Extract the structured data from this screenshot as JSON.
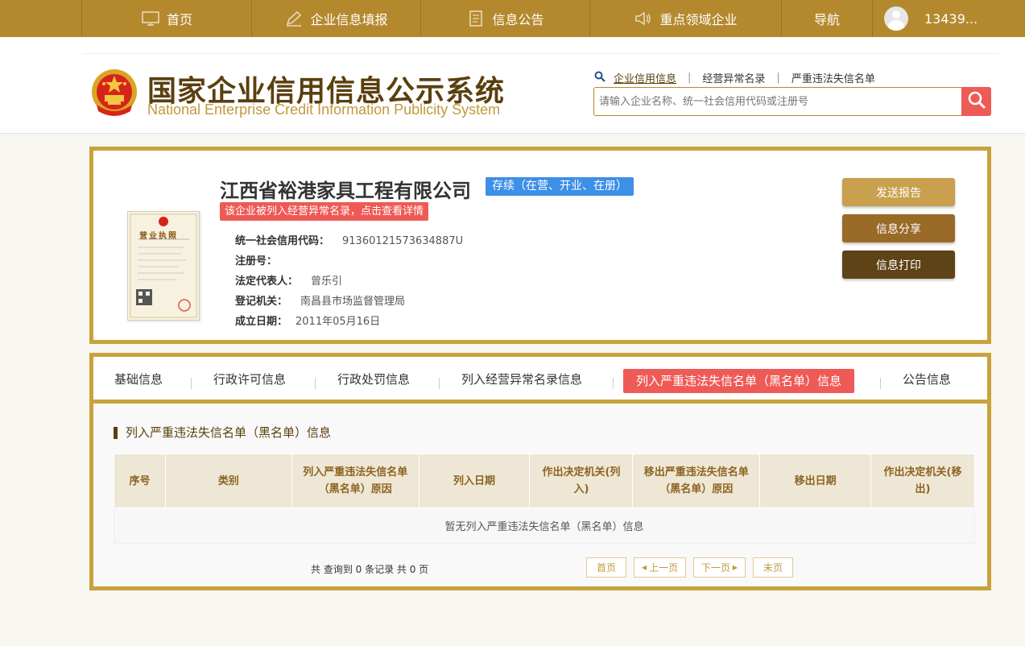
{
  "nav": {
    "items": [
      {
        "label": "首页",
        "icon": "monitor-icon"
      },
      {
        "label": "企业信息填报",
        "icon": "pen-icon"
      },
      {
        "label": "信息公告",
        "icon": "document-icon"
      },
      {
        "label": "重点领域企业",
        "icon": "speaker-icon"
      },
      {
        "label": "导航",
        "icon": ""
      }
    ],
    "user_name": "13439..."
  },
  "header": {
    "title_cn": "国家企业信用信息公示系统",
    "title_en": "National Enterprise Credit Information Publicity System",
    "search_tabs": [
      "企业信用信息",
      "经营异常名录",
      "严重违法失信名单"
    ],
    "search_placeholder": "请输入企业名称、统一社会信用代码或注册号"
  },
  "company": {
    "name": "江西省裕港家具工程有限公司",
    "status": "存续（在营、开业、在册）",
    "alert": "该企业被列入经营异常名录，点击查看详情",
    "fields": [
      {
        "label": "统一社会信用代码：",
        "value": "91360121573634887U"
      },
      {
        "label": "注册号：",
        "value": ""
      },
      {
        "label": "法定代表人：",
        "value": "曾乐引"
      },
      {
        "label": "登记机关：",
        "value": "南昌县市场监督管理局"
      },
      {
        "label": "成立日期：",
        "value": "2011年05月16日"
      }
    ],
    "license_title": "营业执照",
    "actions": [
      "发送报告",
      "信息分享",
      "信息打印"
    ]
  },
  "tabs": [
    "基础信息",
    "行政许可信息",
    "行政处罚信息",
    "列入经营异常名录信息",
    "列入严重违法失信名单（黑名单）信息",
    "公告信息"
  ],
  "section": {
    "title": "列入严重违法失信名单（黑名单）信息",
    "columns": [
      "序号",
      "类别",
      "列入严重违法失信名单（黑名单）原因",
      "列入日期",
      "作出决定机关(列入)",
      "移出严重违法失信名单（黑名单）原因",
      "移出日期",
      "作出决定机关(移出)"
    ],
    "empty_text": "暂无列入严重违法失信名单（黑名单）信息",
    "page_info": "共 查询到 0 条记录 共 0 页",
    "pager": [
      "首页",
      "上一页",
      "下一页",
      "末页"
    ]
  },
  "colors": {
    "nav_bg": "#b4892e",
    "border_gold": "#c9a23c",
    "accent_red": "#ee5a56",
    "badge_blue": "#3d8fe8"
  }
}
